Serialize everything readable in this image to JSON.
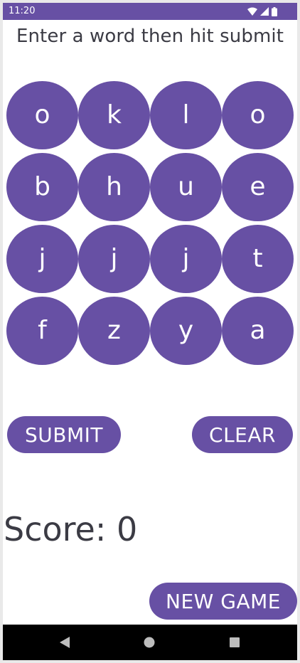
{
  "status_bar": {
    "time": "11:20",
    "icons": [
      "wifi-icon",
      "cell-signal-icon",
      "battery-icon"
    ]
  },
  "instruction": "Enter a word then hit submit",
  "grid": {
    "rows": [
      [
        "o",
        "k",
        "l",
        "o"
      ],
      [
        "b",
        "h",
        "u",
        "e"
      ],
      [
        "j",
        "j",
        "j",
        "t"
      ],
      [
        "f",
        "z",
        "y",
        "a"
      ]
    ]
  },
  "buttons": {
    "submit": "SUBMIT",
    "clear": "CLEAR",
    "new_game": "NEW GAME"
  },
  "score": "Score: 0",
  "nav": {
    "icons": [
      "back-icon",
      "home-icon",
      "recents-icon"
    ]
  },
  "colors": {
    "accent": "#6750a4",
    "text": "#3b3b44",
    "nav_bar": "#000000"
  }
}
